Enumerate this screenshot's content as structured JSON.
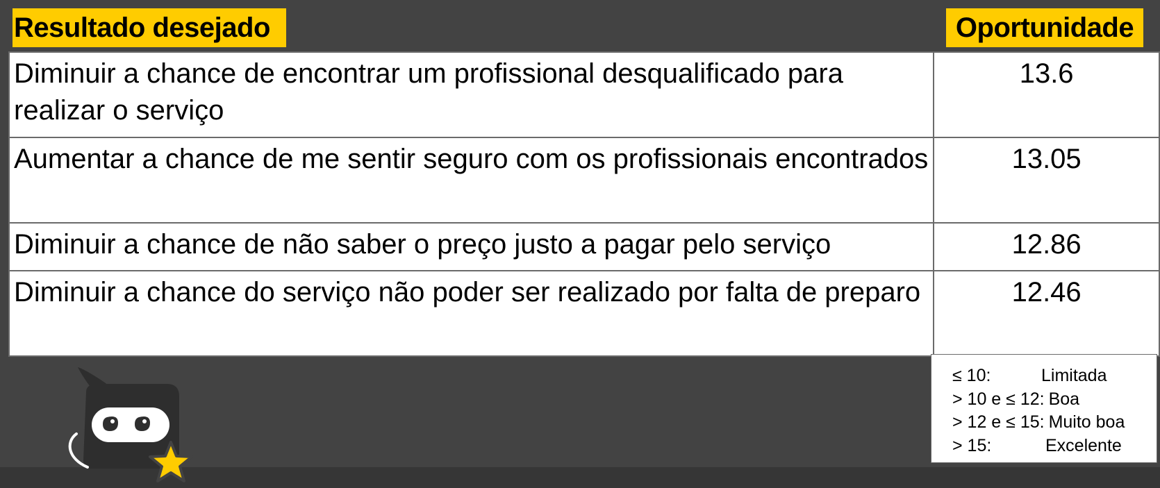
{
  "header": {
    "left_label": "Resultado desejado",
    "right_label": "Oportunidade"
  },
  "rows": [
    {
      "outcome": "Diminuir a chance de encontrar um profissional desqualificado para realizar o serviço",
      "score": "13.6"
    },
    {
      "outcome": "Aumentar a chance de me sentir seguro com os profissionais encontrados",
      "score": "13.05"
    },
    {
      "outcome": "Diminuir a chance de não saber o preço justo a pagar pelo serviço",
      "score": "12.86"
    },
    {
      "outcome": "Diminuir a chance do serviço não poder ser realizado por falta de preparo",
      "score": "12.46"
    }
  ],
  "legend": [
    {
      "range": "≤ 10:",
      "label": "Limitada"
    },
    {
      "range": "> 10 e ≤ 12:",
      "label": "Boa"
    },
    {
      "range": "> 12 e ≤ 15:",
      "label": "Muito boa"
    },
    {
      "range": "> 15:",
      "label": "Excelente"
    }
  ],
  "colors": {
    "background": "#434343",
    "header_highlight": "#ffcc00",
    "mascot_body": "#2e2e2e",
    "mascot_star": "#ffcc00"
  },
  "icons": {
    "mascot": "ninja-mascot-icon",
    "star": "star-icon"
  }
}
